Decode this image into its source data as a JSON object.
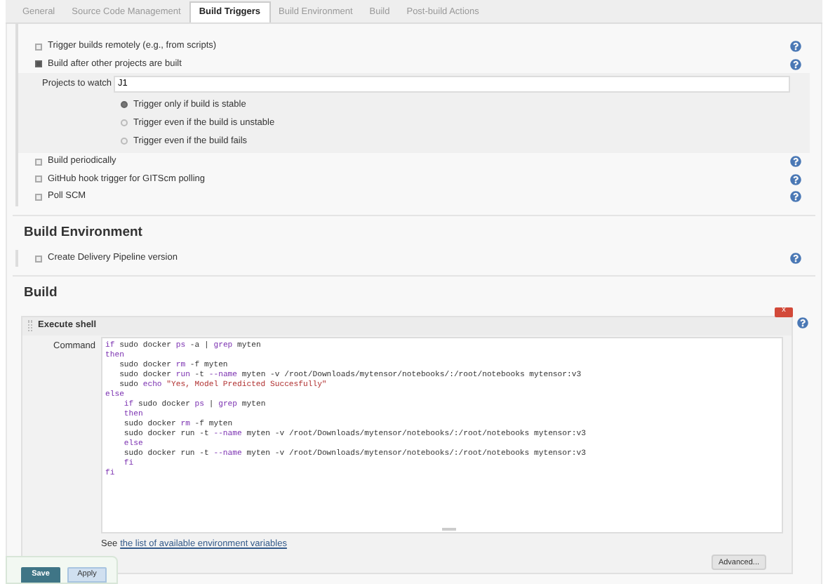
{
  "tabs": [
    {
      "label": "General",
      "selected": false
    },
    {
      "label": "Source Code Management",
      "selected": false
    },
    {
      "label": "Build Triggers",
      "selected": true
    },
    {
      "label": "Build Environment",
      "selected": false
    },
    {
      "label": "Build",
      "selected": false
    },
    {
      "label": "Post-build Actions",
      "selected": false
    }
  ],
  "build_triggers": {
    "options_top": [
      {
        "label": "Trigger builds remotely (e.g., from scripts)",
        "checked": false
      },
      {
        "label": "Build after other projects are built",
        "checked": true
      }
    ],
    "projects_to_watch": {
      "label": "Projects to watch",
      "value": "J1"
    },
    "trigger_options": [
      {
        "label": "Trigger only if build is stable",
        "selected": true
      },
      {
        "label": "Trigger even if the build is unstable",
        "selected": false
      },
      {
        "label": "Trigger even if the build fails",
        "selected": false
      }
    ],
    "options_bottom": [
      {
        "label": "Build periodically",
        "checked": false
      },
      {
        "label": "GitHub hook trigger for GITScm polling",
        "checked": false
      },
      {
        "label": "Poll SCM",
        "checked": false
      }
    ]
  },
  "build_environment": {
    "title": "Build Environment",
    "options": [
      {
        "label": "Create Delivery Pipeline version",
        "checked": false
      }
    ]
  },
  "build": {
    "title": "Build",
    "step": {
      "title": "Execute shell",
      "delete": "x",
      "command_label": "Command",
      "lines": [
        [
          {
            "kind": "kw",
            "text": "if"
          },
          {
            "kind": "plain",
            "text": " sudo docker "
          },
          {
            "kind": "kw",
            "text": "ps"
          },
          {
            "kind": "plain",
            "text": " -a | "
          },
          {
            "kind": "kw",
            "text": "grep"
          },
          {
            "kind": "plain",
            "text": " myten"
          }
        ],
        [
          {
            "kind": "kw",
            "text": "then"
          }
        ],
        [
          {
            "kind": "plain",
            "text": "   sudo docker "
          },
          {
            "kind": "kw",
            "text": "rm"
          },
          {
            "kind": "plain",
            "text": " -f myten"
          }
        ],
        [
          {
            "kind": "plain",
            "text": "   sudo docker "
          },
          {
            "kind": "kw",
            "text": "run"
          },
          {
            "kind": "plain",
            "text": " -t "
          },
          {
            "kind": "kw",
            "text": "--name"
          },
          {
            "kind": "plain",
            "text": " myten -v /root/Downloads/mytensor/notebooks/:/root/notebooks mytensor:v3"
          }
        ],
        [
          {
            "kind": "plain",
            "text": "   sudo "
          },
          {
            "kind": "kw",
            "text": "echo"
          },
          {
            "kind": "str",
            "text": " \"Yes, Model Predicted Succesfully\""
          }
        ],
        [
          {
            "kind": "kw",
            "text": "else"
          }
        ],
        [
          {
            "kind": "kw",
            "text": "    if"
          },
          {
            "kind": "plain",
            "text": " sudo docker "
          },
          {
            "kind": "kw",
            "text": "ps"
          },
          {
            "kind": "plain",
            "text": " | "
          },
          {
            "kind": "kw",
            "text": "grep"
          },
          {
            "kind": "plain",
            "text": " myten"
          }
        ],
        [
          {
            "kind": "kw",
            "text": "    then"
          }
        ],
        [
          {
            "kind": "plain",
            "text": "    sudo docker "
          },
          {
            "kind": "kw",
            "text": "rm"
          },
          {
            "kind": "plain",
            "text": " -f myten"
          }
        ],
        [
          {
            "kind": "plain",
            "text": "    sudo docker run -t "
          },
          {
            "kind": "kw",
            "text": "--name"
          },
          {
            "kind": "plain",
            "text": " myten -v /root/Downloads/mytensor/notebooks/:/root/notebooks mytensor:v3"
          }
        ],
        [
          {
            "kind": "kw",
            "text": "    else"
          }
        ],
        [
          {
            "kind": "plain",
            "text": "    sudo docker run -t "
          },
          {
            "kind": "kw",
            "text": "--name"
          },
          {
            "kind": "plain",
            "text": " myten -v /root/Downloads/mytensor/notebooks/:/root/notebooks mytensor:v3"
          }
        ],
        [
          {
            "kind": "kw",
            "text": "    fi"
          }
        ],
        [
          {
            "kind": "kw",
            "text": "fi"
          }
        ]
      ],
      "see_text": "See",
      "link": "the list of available environment variables",
      "advanced_button": "Advanced..."
    }
  },
  "buttons": [
    {
      "label": "Save",
      "kind": "primary"
    },
    {
      "label": "Apply",
      "kind": "secondary"
    }
  ]
}
